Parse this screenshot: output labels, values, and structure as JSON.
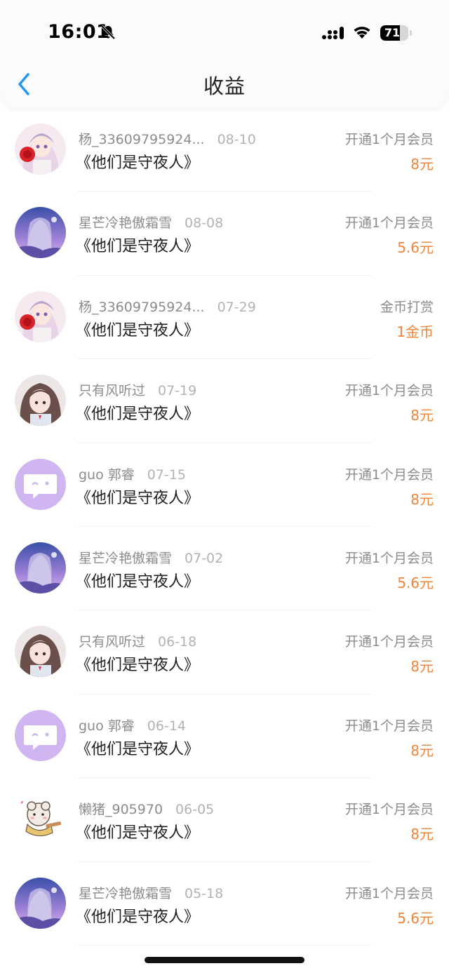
{
  "status_bar": {
    "time": "16:01",
    "battery": "71",
    "battery_level": 0.71
  },
  "nav": {
    "title": "收益"
  },
  "colors": {
    "accent_blue": "#2196f3",
    "amount_orange": "#f0853a"
  },
  "income_list": [
    {
      "user": "杨_33609795924...",
      "date": "08-10",
      "book": "《他们是守夜人》",
      "type": "开通1个月会员",
      "amount": "8元",
      "avatar": "anime-girl-red-fan"
    },
    {
      "user": "星芒冷艳傲霜雪",
      "date": "08-08",
      "book": "《他们是守夜人》",
      "type": "开通1个月会员",
      "amount": "5.6元",
      "avatar": "anime-girl-purple-sky"
    },
    {
      "user": "杨_33609795924...",
      "date": "07-29",
      "book": "《他们是守夜人》",
      "type": "金币打赏",
      "amount": "1金币",
      "avatar": "anime-girl-red-fan"
    },
    {
      "user": "只有风听过",
      "date": "07-19",
      "book": "《他们是守夜人》",
      "type": "开通1个月会员",
      "amount": "8元",
      "avatar": "anime-girl-brown-hair"
    },
    {
      "user": "guo 郭睿",
      "date": "07-15",
      "book": "《他们是守夜人》",
      "type": "开通1个月会员",
      "amount": "8元",
      "avatar": "default-chat-avatar"
    },
    {
      "user": "星芒冷艳傲霜雪",
      "date": "07-02",
      "book": "《他们是守夜人》",
      "type": "开通1个月会员",
      "amount": "5.6元",
      "avatar": "anime-girl-purple-sky"
    },
    {
      "user": "只有风听过",
      "date": "06-18",
      "book": "《他们是守夜人》",
      "type": "开通1个月会员",
      "amount": "8元",
      "avatar": "anime-girl-brown-hair"
    },
    {
      "user": "guo 郭睿",
      "date": "06-14",
      "book": "《他们是守夜人》",
      "type": "开通1个月会员",
      "amount": "8元",
      "avatar": "default-chat-avatar"
    },
    {
      "user": "懒猪_905970",
      "date": "06-05",
      "book": "《他们是守夜人》",
      "type": "开通1个月会员",
      "amount": "8元",
      "avatar": "cartoon-sheep"
    },
    {
      "user": "星芒冷艳傲霜雪",
      "date": "05-18",
      "book": "《他们是守夜人》",
      "type": "开通1个月会员",
      "amount": "5.6元",
      "avatar": "anime-girl-purple-sky"
    }
  ]
}
